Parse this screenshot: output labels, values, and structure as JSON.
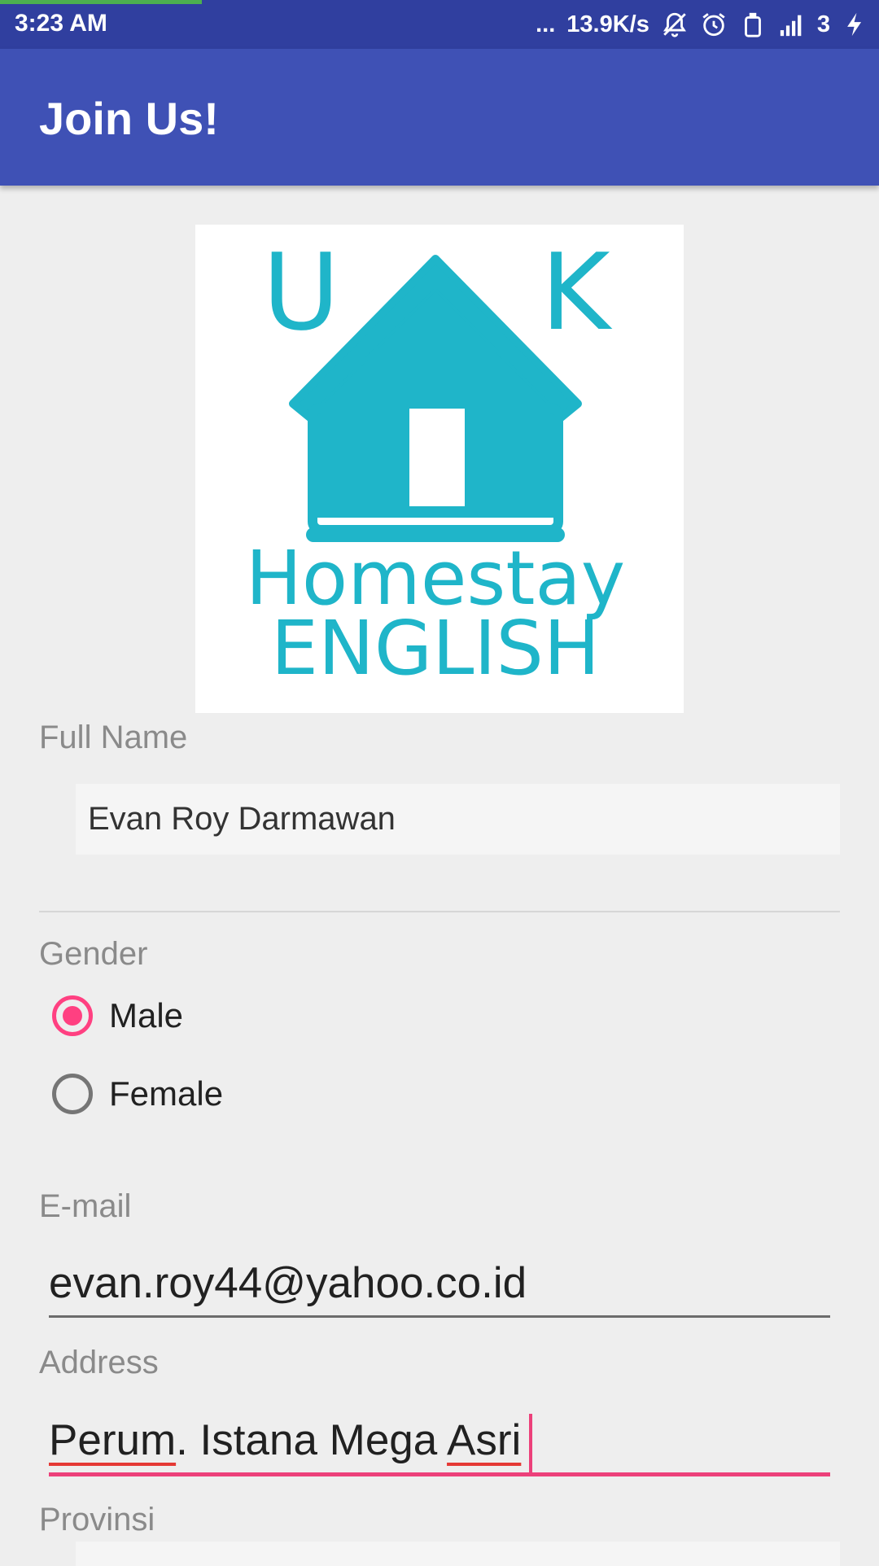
{
  "status_bar": {
    "time": "3:23 AM",
    "more": "...",
    "speed": "13.9K/s",
    "sim": "3",
    "icons": [
      "mute-icon",
      "alarm-icon",
      "phone-icon",
      "signal-icon",
      "charging-icon"
    ]
  },
  "app_bar": {
    "title": "Join Us!"
  },
  "logo": {
    "letters_left": "U",
    "letters_right": "K",
    "line1": "Homestay",
    "line2": "ENGLISH",
    "color": "#1fb5c9"
  },
  "form": {
    "full_name": {
      "label": "Full Name",
      "value": "Evan Roy Darmawan"
    },
    "gender": {
      "label": "Gender",
      "options": [
        {
          "label": "Male",
          "checked": true
        },
        {
          "label": "Female",
          "checked": false
        }
      ]
    },
    "email": {
      "label": "E-mail",
      "value": "evan.roy44@yahoo.co.id"
    },
    "address": {
      "label": "Address",
      "word1": "Perum",
      "word2": ". Istana Mega ",
      "word3": "Asri"
    },
    "provinsi": {
      "label": "Provinsi"
    }
  },
  "colors": {
    "status_bar": "#303f9f",
    "app_bar": "#3f51b5",
    "accent": "#ff4081"
  }
}
